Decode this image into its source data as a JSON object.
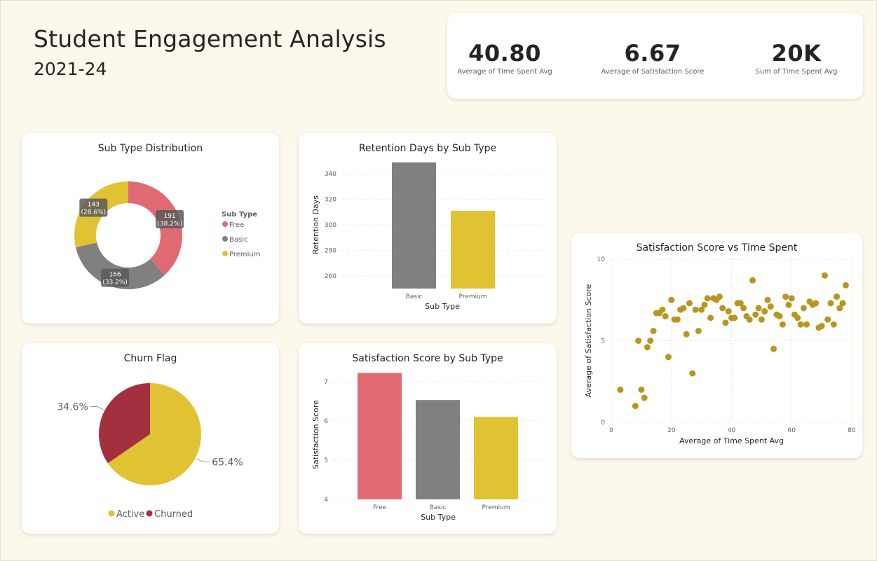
{
  "header": {
    "title": "Student Engagement Analysis",
    "subtitle": "2021-24"
  },
  "kpis": [
    {
      "value": "40.80",
      "label": "Average of Time Spent Avg"
    },
    {
      "value": "6.67",
      "label": "Average of Satisfaction Score"
    },
    {
      "value": "20K",
      "label": "Sum of Time Spent Avg"
    }
  ],
  "colors": {
    "free": "#e06a73",
    "basic": "#808080",
    "premium": "#e1c233",
    "active": "#e1c233",
    "churned": "#a4303f",
    "scatter": "#b8961f",
    "background": "#fdf8ec"
  },
  "chart_data": [
    {
      "type": "pie",
      "variant": "donut",
      "title": "Sub Type Distribution",
      "legend_title": "Sub Type",
      "legend_position": "right",
      "categories": [
        "Free",
        "Basic",
        "Premium"
      ],
      "values": [
        191,
        166,
        143
      ],
      "percent_labels": [
        "(38.2%)",
        "(33.2%)",
        "(28.6%)"
      ]
    },
    {
      "type": "bar",
      "title": "Retention Days by Sub Type",
      "xlabel": "Sub Type",
      "ylabel": "Retention Days",
      "categories": [
        "Basic",
        "Premium"
      ],
      "values": [
        349,
        311
      ],
      "ylim": [
        250,
        350
      ],
      "yticks": [
        260,
        280,
        300,
        320,
        340
      ],
      "grid": true
    },
    {
      "type": "scatter",
      "title": "Satisfaction Score vs Time Spent",
      "xlabel": "Average of Time Spent Avg",
      "ylabel": "Average of Satisfaction Score",
      "xlim": [
        0,
        80
      ],
      "ylim": [
        0,
        10
      ],
      "xticks": [
        0,
        20,
        40,
        60,
        80
      ],
      "yticks": [
        0,
        5,
        10
      ],
      "grid": true,
      "points": [
        [
          3,
          2.0
        ],
        [
          8,
          1.0
        ],
        [
          9,
          5.0
        ],
        [
          10,
          2.0
        ],
        [
          11,
          1.5
        ],
        [
          12,
          4.6
        ],
        [
          13,
          5.0
        ],
        [
          14,
          5.6
        ],
        [
          15,
          6.7
        ],
        [
          16,
          6.7
        ],
        [
          17,
          6.9
        ],
        [
          18,
          6.5
        ],
        [
          19,
          4.0
        ],
        [
          20,
          7.5
        ],
        [
          21,
          6.3
        ],
        [
          22,
          6.3
        ],
        [
          23,
          6.9
        ],
        [
          24,
          7.0
        ],
        [
          25,
          5.4
        ],
        [
          26,
          7.3
        ],
        [
          27,
          3.0
        ],
        [
          28,
          6.9
        ],
        [
          29,
          5.6
        ],
        [
          30,
          6.9
        ],
        [
          31,
          7.2
        ],
        [
          32,
          7.6
        ],
        [
          33,
          6.4
        ],
        [
          34,
          7.6
        ],
        [
          35,
          7.5
        ],
        [
          36,
          7.7
        ],
        [
          37,
          7.0
        ],
        [
          38,
          6.1
        ],
        [
          39,
          6.8
        ],
        [
          40,
          6.4
        ],
        [
          41,
          6.4
        ],
        [
          42,
          7.3
        ],
        [
          43,
          7.3
        ],
        [
          44,
          7.0
        ],
        [
          45,
          6.5
        ],
        [
          46,
          6.3
        ],
        [
          47,
          8.7
        ],
        [
          48,
          6.6
        ],
        [
          49,
          7.0
        ],
        [
          50,
          6.3
        ],
        [
          51,
          6.8
        ],
        [
          52,
          7.5
        ],
        [
          53,
          7.1
        ],
        [
          54,
          4.5
        ],
        [
          55,
          6.6
        ],
        [
          56,
          6.5
        ],
        [
          57,
          6.0
        ],
        [
          58,
          7.7
        ],
        [
          59,
          7.2
        ],
        [
          60,
          7.6
        ],
        [
          61,
          6.6
        ],
        [
          62,
          6.4
        ],
        [
          63,
          6.0
        ],
        [
          64,
          7.0
        ],
        [
          65,
          6.0
        ],
        [
          66,
          7.4
        ],
        [
          67,
          7.2
        ],
        [
          68,
          7.3
        ],
        [
          69,
          5.8
        ],
        [
          70,
          5.9
        ],
        [
          71,
          9.0
        ],
        [
          72,
          6.3
        ],
        [
          73,
          7.3
        ],
        [
          74,
          6.0
        ],
        [
          75,
          7.7
        ],
        [
          76,
          7.0
        ],
        [
          77,
          7.3
        ],
        [
          78,
          8.4
        ]
      ]
    },
    {
      "type": "pie",
      "title": "Churn Flag",
      "legend_position": "bottom-center",
      "categories": [
        "Active",
        "Churned"
      ],
      "values": [
        65.4,
        34.6
      ],
      "value_labels": [
        "65.4%",
        "34.6%"
      ]
    },
    {
      "type": "bar",
      "title": "Satisfaction Score by Sub Type",
      "xlabel": "Sub Type",
      "ylabel": "Satisfaction Score",
      "categories": [
        "Free",
        "Basic",
        "Premium"
      ],
      "values": [
        7.22,
        6.53,
        6.1
      ],
      "ylim": [
        4,
        7.3
      ],
      "yticks": [
        4,
        5,
        6,
        7
      ],
      "grid": true
    }
  ]
}
